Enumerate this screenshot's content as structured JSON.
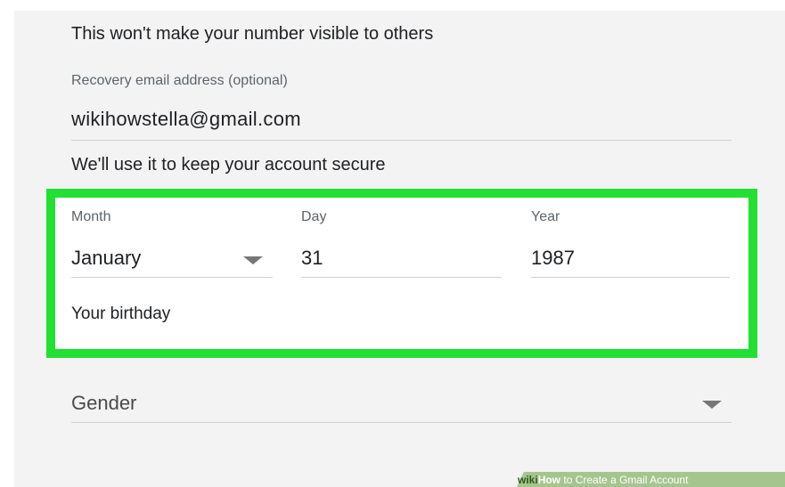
{
  "phone": {
    "hint": "This won't make your number visible to others"
  },
  "recovery_email": {
    "label": "Recovery email address (optional)",
    "value": "wikihowstella@gmail.com",
    "hint": "We'll use it to keep your account secure"
  },
  "birthday": {
    "month_label": "Month",
    "month_value": "January",
    "day_label": "Day",
    "day_value": "31",
    "year_label": "Year",
    "year_value": "1987",
    "hint": "Your birthday",
    "highlight_color": "#22e033"
  },
  "gender": {
    "placeholder": "Gender"
  },
  "watermark": {
    "brand_wiki": "wiki",
    "brand_how": "How",
    "title": "to Create a Gmail Account"
  }
}
